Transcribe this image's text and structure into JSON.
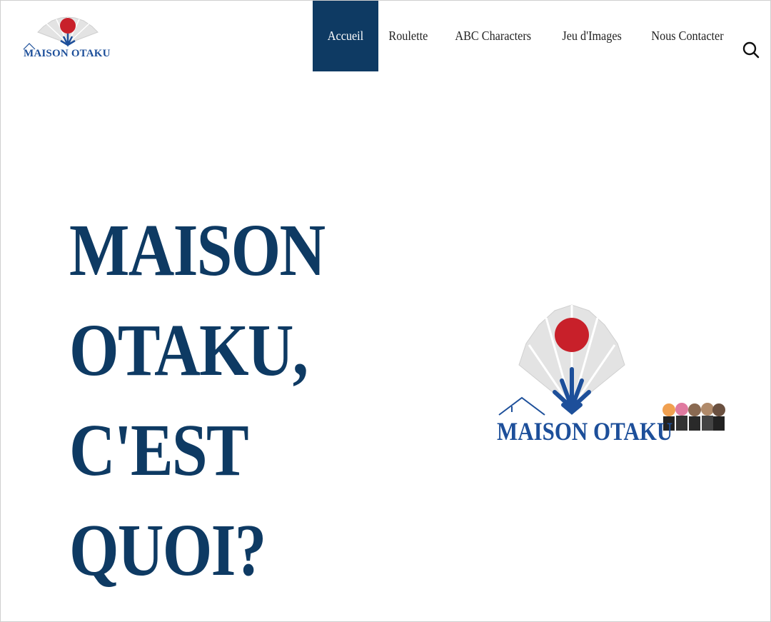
{
  "header": {
    "logo_text": "MAISON OTAKU",
    "nav": [
      {
        "label": "Accueil",
        "active": true
      },
      {
        "label": "Roulette",
        "active": false
      },
      {
        "label": "ABC Characters",
        "active": false
      },
      {
        "label": "Jeu d'Images",
        "active": false
      },
      {
        "label": "Nous Contacter",
        "active": false
      }
    ],
    "search_icon": "search-icon"
  },
  "hero": {
    "title_lines": [
      "MAISON",
      "OTAKU,",
      "C'EST",
      "QUOI?"
    ],
    "logo_text": "MAISON OTAKU"
  },
  "colors": {
    "navy": "#0e3a63",
    "logo_blue": "#1d4f9a",
    "sun_red": "#c8202a",
    "fan_gray": "#d9d9d9"
  }
}
